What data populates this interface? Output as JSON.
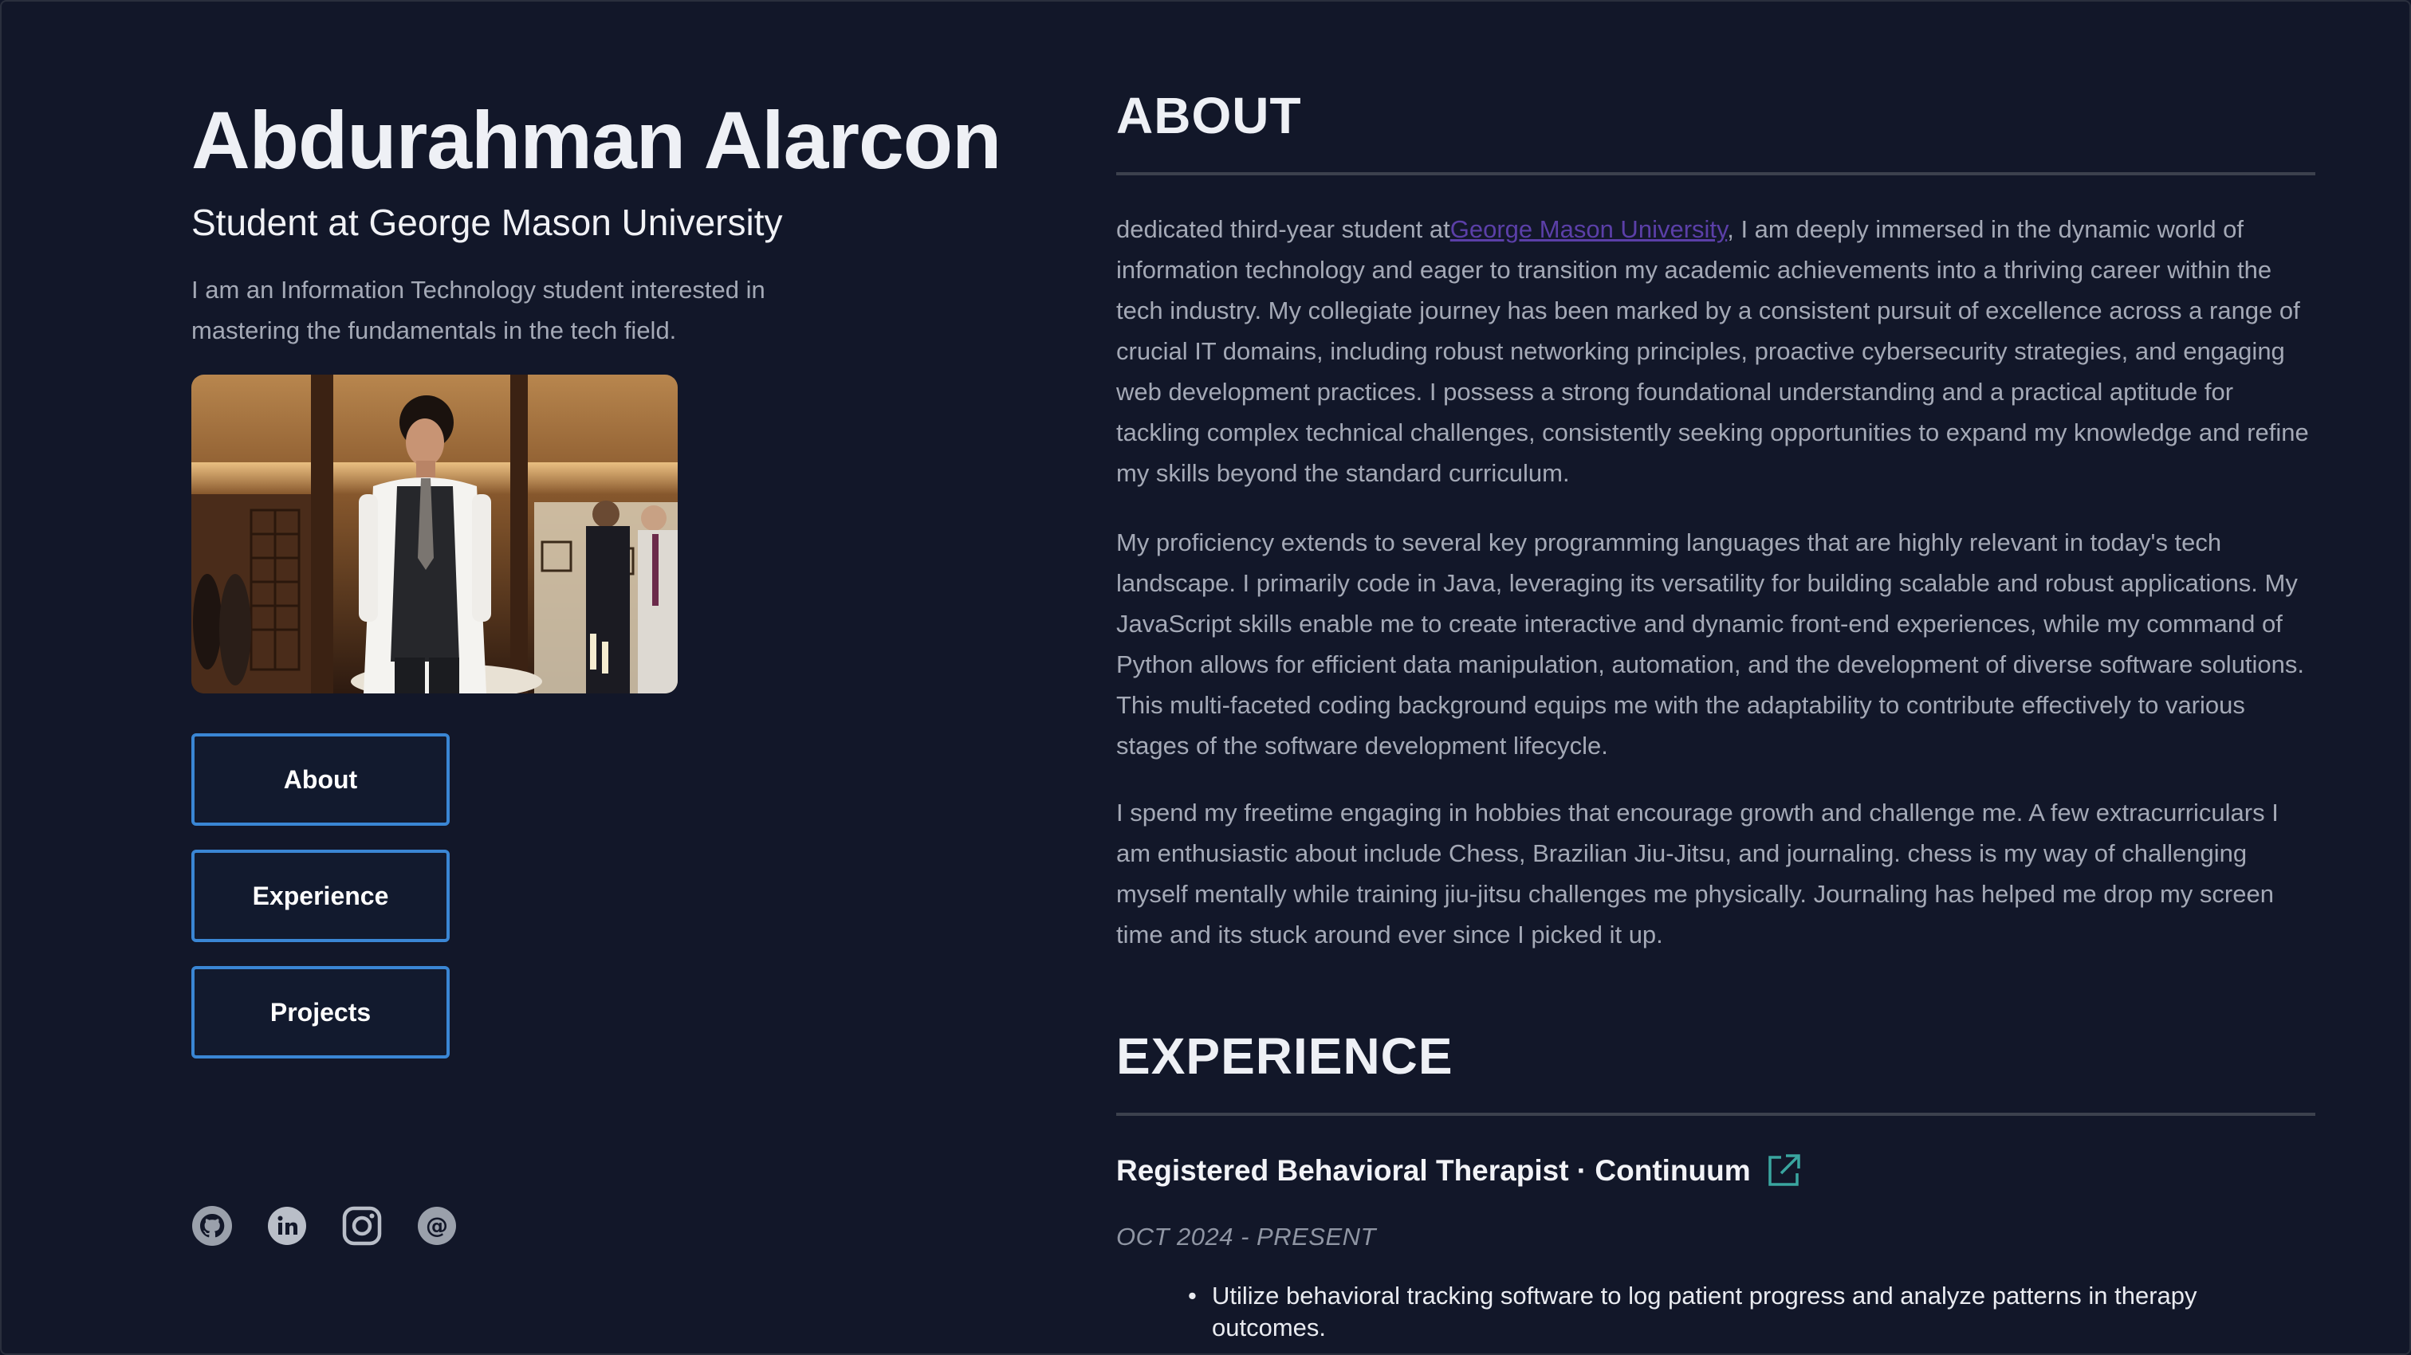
{
  "profile": {
    "name": "Abdurahman Alarcon",
    "title": "Student at George Mason University",
    "intro": "I am an Information Technology student interested in mastering the fundamentals in the tech field."
  },
  "nav": {
    "about": "About",
    "experience": "Experience",
    "projects": "Projects"
  },
  "social": [
    "github-icon",
    "linkedin-icon",
    "instagram-icon",
    "email-icon"
  ],
  "about": {
    "heading": "ABOUT",
    "p1_before": "dedicated third-year student at",
    "p1_link": "George Mason University",
    "p1_after": ", I am deeply immersed in the dynamic world of information technology and eager to transition my academic achievements into a thriving career within the tech industry. My collegiate journey has been marked by a consistent pursuit of excellence across a range of crucial IT domains, including robust networking principles, proactive cybersecurity strategies, and engaging web development practices. I possess a strong foundational understanding and a practical aptitude for tackling complex technical challenges, consistently seeking opportunities to expand my knowledge and refine my skills beyond the standard curriculum.",
    "p2": "My proficiency extends to several key programming languages that are highly relevant in today's tech landscape. I primarily code in Java, leveraging its versatility for building scalable and robust applications. My JavaScript skills enable me to create interactive and dynamic front-end experiences, while my command of Python allows for efficient data manipulation, automation, and the development of diverse software solutions. This multi-faceted coding background equips me with the adaptability to contribute effectively to various stages of the software development lifecycle.",
    "p3": "I spend my freetime engaging in hobbies that encourage growth and challenge me. A few extracurriculars I am enthusiastic about include Chess, Brazilian Jiu-Jitsu, and journaling. chess is my way of challenging myself mentally while training jiu-jitsu challenges me physically. Journaling has helped me drop my screen time and its stuck around ever since I picked it up."
  },
  "experience": {
    "heading": "EXPERIENCE",
    "jobs": [
      {
        "title": "Registered Behavioral Therapist · Continuum",
        "date": "OCT 2024 - PRESENT",
        "bullets": [
          "Utilize behavioral tracking software to log patient progress and analyze patterns in therapy outcomes."
        ]
      }
    ]
  },
  "colors": {
    "background": "#121729",
    "button_border": "#3a86d4",
    "link": "#5b3fa8",
    "external_icon": "#3aa6a0"
  }
}
